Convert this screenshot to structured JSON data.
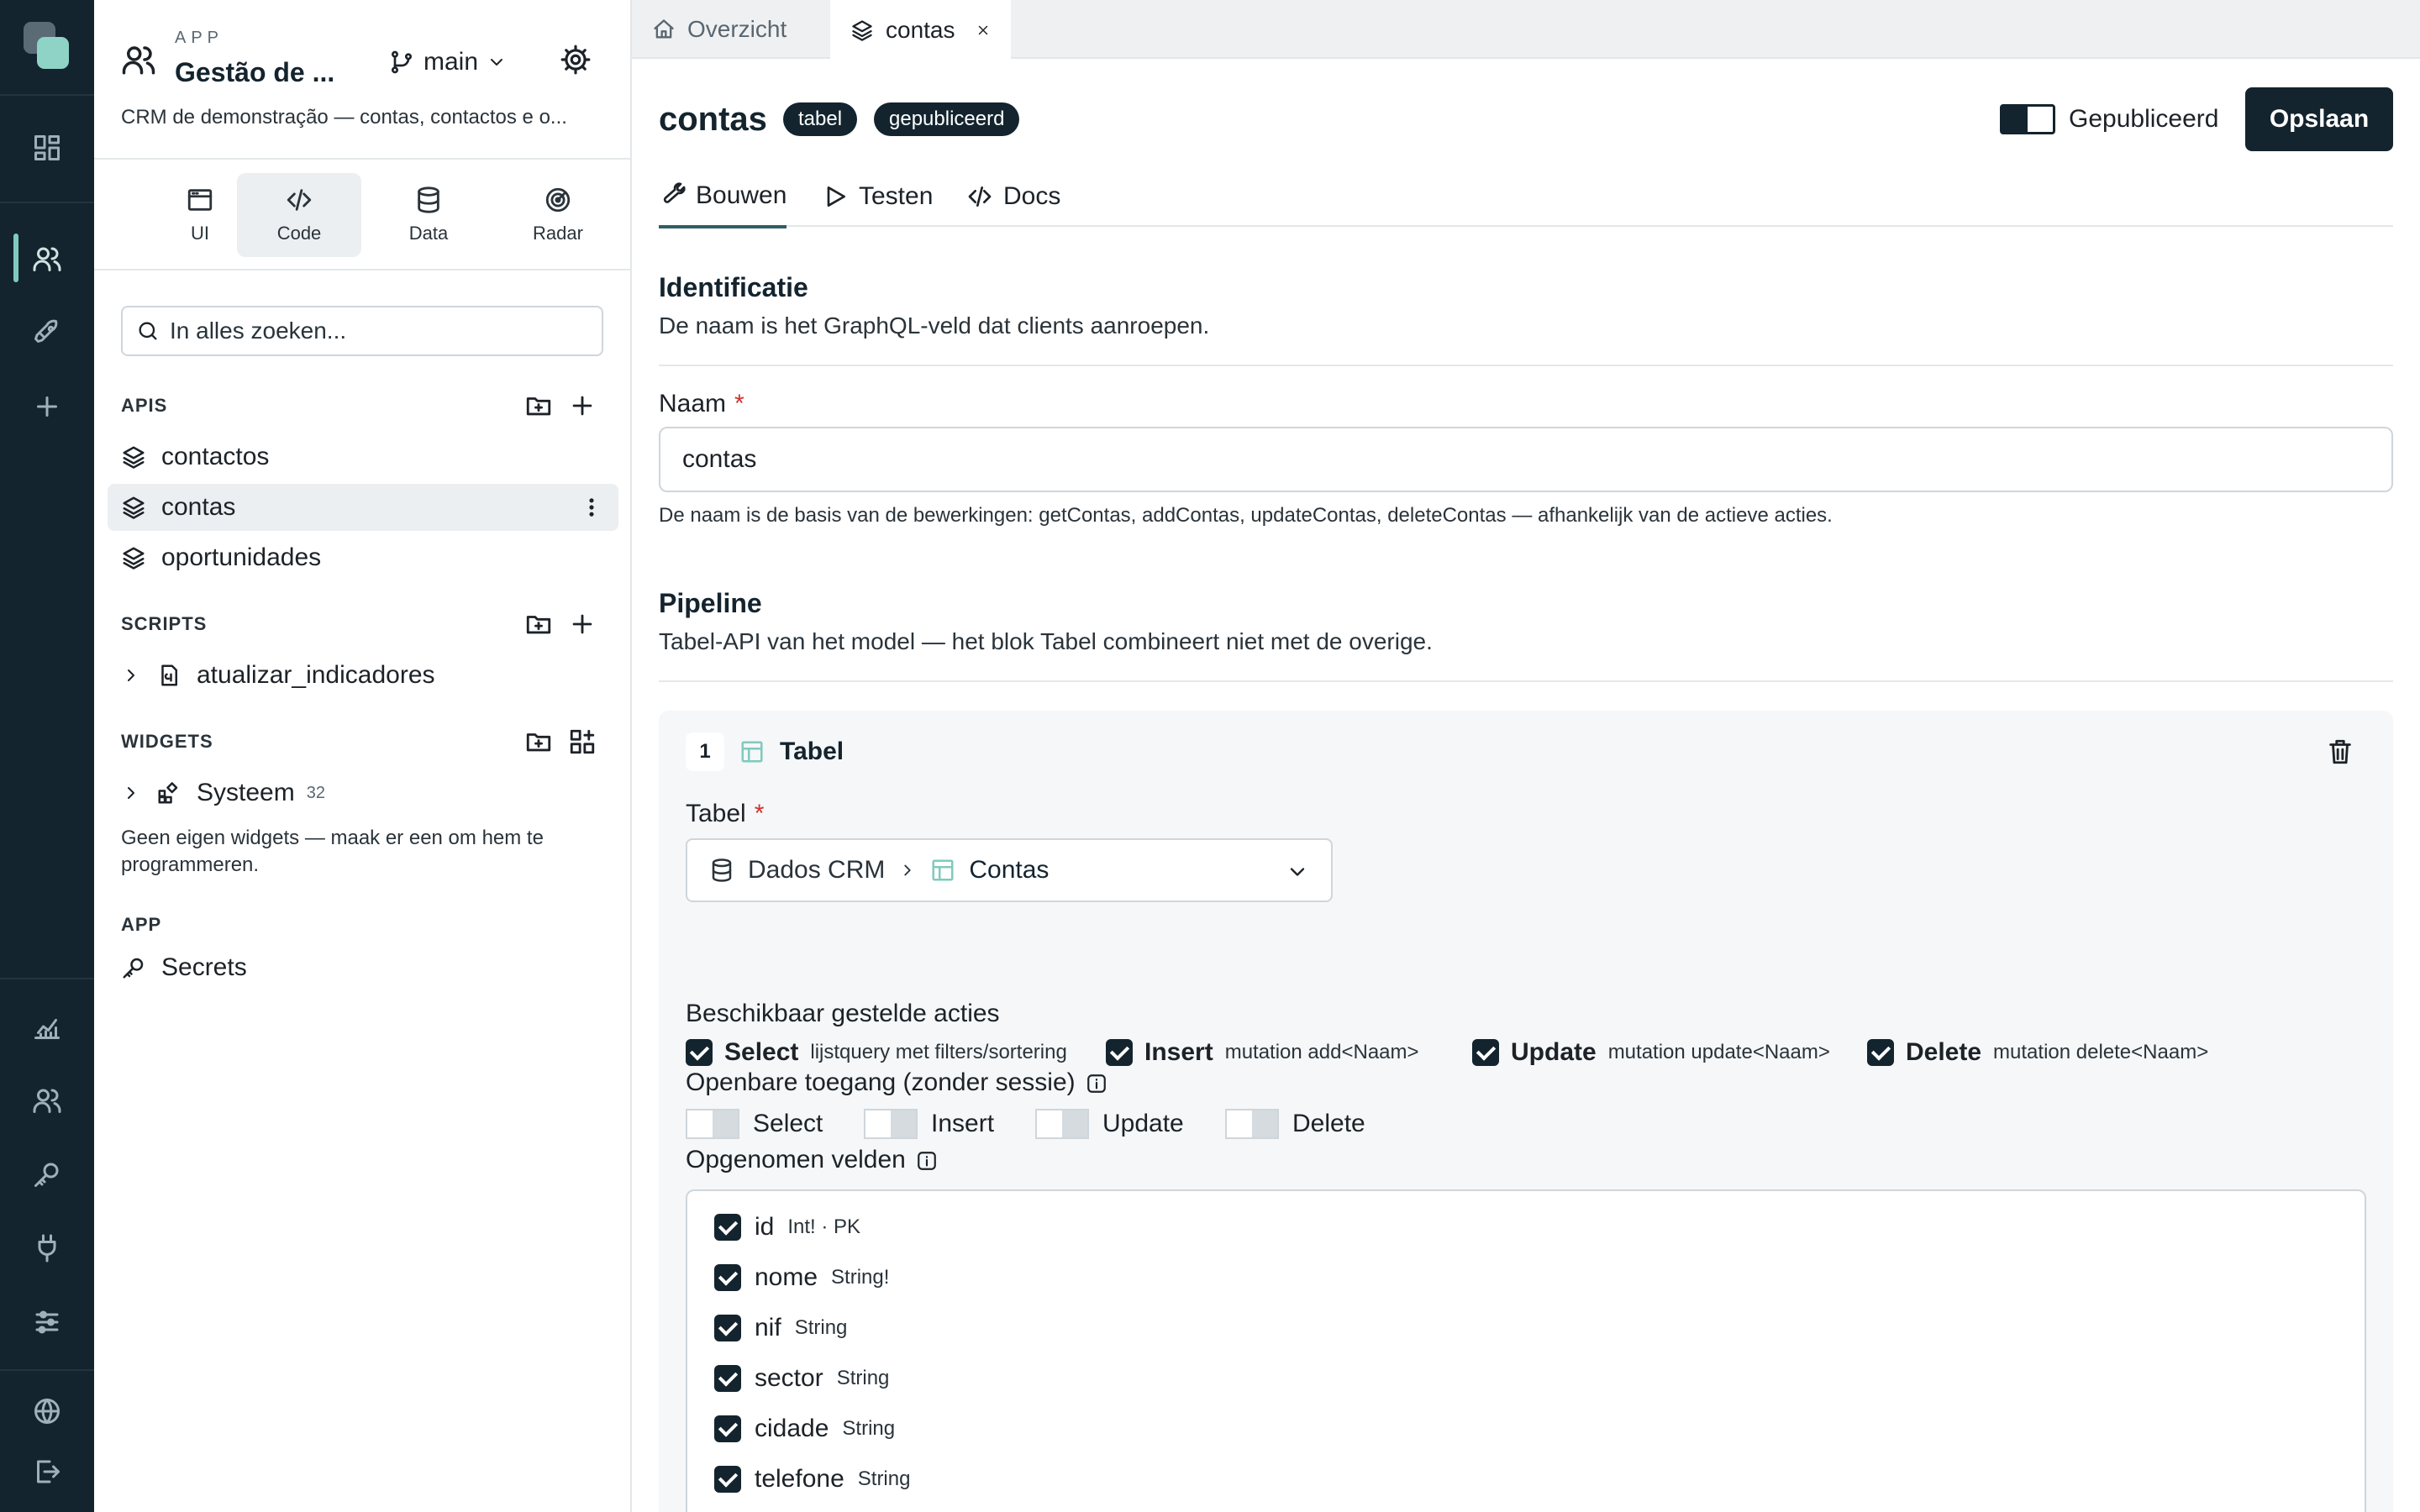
{
  "app": {
    "kicker": "APP",
    "title": "Gestão de ...",
    "branch": "main",
    "description": "CRM de demonstração — contas, contactos e o..."
  },
  "modes": [
    {
      "label": "UI",
      "icon": "browser-window-icon"
    },
    {
      "label": "Code",
      "icon": "code-icon",
      "active": true
    },
    {
      "label": "Data",
      "icon": "database-icon"
    },
    {
      "label": "Radar",
      "icon": "radar-icon"
    }
  ],
  "search": {
    "placeholder": "In alles zoeken..."
  },
  "sections": {
    "apis": {
      "title": "APIS",
      "items": [
        {
          "label": "contactos"
        },
        {
          "label": "contas",
          "active": true
        },
        {
          "label": "oportunidades"
        }
      ]
    },
    "scripts": {
      "title": "SCRIPTS",
      "items": [
        {
          "label": "atualizar_indicadores"
        }
      ]
    },
    "widgets": {
      "title": "WIDGETS",
      "items": [
        {
          "label": "Systeem",
          "count": "32"
        }
      ],
      "empty_note": "Geen eigen widgets — maak er een om hem te programmeren."
    },
    "app": {
      "title": "APP",
      "items": [
        {
          "label": "Secrets"
        }
      ]
    }
  },
  "tabs": [
    {
      "label": "Overzicht"
    },
    {
      "label": "contas",
      "active": true
    }
  ],
  "page": {
    "title": "contas",
    "badges": [
      "tabel",
      "gepubliceerd"
    ],
    "published_label": "Gepubliceerd",
    "published": true,
    "save_label": "Opslaan"
  },
  "subtabs": [
    {
      "label": "Bouwen",
      "active": true
    },
    {
      "label": "Testen"
    },
    {
      "label": "Docs"
    }
  ],
  "identification": {
    "heading": "Identificatie",
    "description": "De naam is het GraphQL-veld dat clients aanroepen.",
    "name_label": "Naam",
    "required_mark": "*",
    "name_value": "contas",
    "hint": "De naam is de basis van de bewerkingen: getContas, addContas, updateContas, deleteContas — afhankelijk van de actieve acties."
  },
  "pipeline": {
    "heading": "Pipeline",
    "description": "Tabel-API van het model — het blok Tabel combineert niet met de overige.",
    "block": {
      "step": "1",
      "title": "Tabel",
      "table_label": "Tabel",
      "required_mark": "*",
      "source": "Dados CRM",
      "table": "Contas",
      "actions_label": "Beschikbaar gestelde acties",
      "actions": [
        {
          "name": "Select",
          "desc": "lijstquery met filters/sortering",
          "checked": true
        },
        {
          "name": "Insert",
          "desc": "mutation add<Naam>",
          "checked": true
        },
        {
          "name": "Update",
          "desc": "mutation update<Naam>",
          "checked": true
        },
        {
          "name": "Delete",
          "desc": "mutation delete<Naam>",
          "checked": true
        }
      ],
      "public_label": "Openbare toegang (zonder sessie)",
      "public_access": [
        {
          "name": "Select",
          "on": false
        },
        {
          "name": "Insert",
          "on": false
        },
        {
          "name": "Update",
          "on": false
        },
        {
          "name": "Delete",
          "on": false
        }
      ],
      "fields_label": "Opgenomen velden",
      "fields": [
        {
          "name": "id",
          "type": "Int! · PK",
          "checked": true
        },
        {
          "name": "nome",
          "type": "String!",
          "checked": true
        },
        {
          "name": "nif",
          "type": "String",
          "checked": true
        },
        {
          "name": "sector",
          "type": "String",
          "checked": true
        },
        {
          "name": "cidade",
          "type": "String",
          "checked": true
        },
        {
          "name": "telefone",
          "type": "String",
          "checked": true
        }
      ]
    }
  }
}
